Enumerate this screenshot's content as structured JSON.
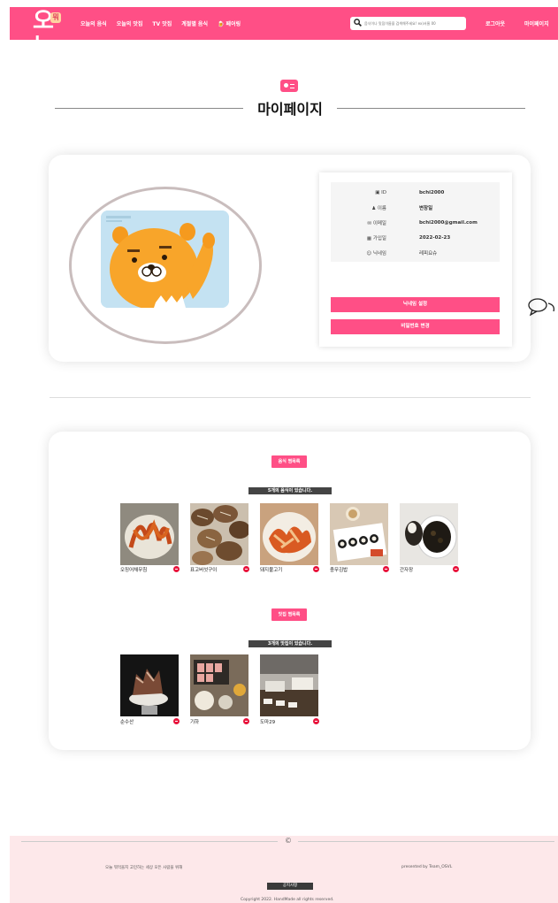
{
  "header": {
    "logo_text": "오늘",
    "logo_badge": "뭐",
    "nav": [
      "오늘의 음식",
      "오늘의 맛집",
      "TV 맛집",
      "계절별 음식",
      "🍺 페어링"
    ],
    "search_placeholder": "음식이나 맛집이름을 검색해주세요! ex)서울 00",
    "logout": "로그아웃",
    "mypage": "마이페이지"
  },
  "page": {
    "title": "마이페이지"
  },
  "profile": {
    "rows": [
      {
        "icon": "id-card-icon",
        "label": "ID",
        "value": "bchi2000"
      },
      {
        "icon": "person-icon",
        "label": "이름",
        "value": "변창일"
      },
      {
        "icon": "mail-icon",
        "label": "이메일",
        "value": "bchi2000@gmail.com"
      },
      {
        "icon": "calendar-icon",
        "label": "가입일",
        "value": "2022-02-23"
      },
      {
        "icon": "smile-icon",
        "label": "닉네임",
        "value": "레피요슈"
      }
    ],
    "nickname_button": "닉네임 설정",
    "password_button": "비밀번호 변경"
  },
  "food_bookmarks": {
    "button": "음식 찜목록",
    "count_text": "5개의 음식이 있습니다.",
    "items": [
      "오징어채무침",
      "표고버섯구이",
      "돼지불고기",
      "충무김밥",
      "간자장"
    ]
  },
  "restaurant_bookmarks": {
    "button": "맛집 찜목록",
    "count_text": "3개의 맛집이 있습니다.",
    "items": [
      "순수산",
      "기하",
      "도마29"
    ]
  },
  "footer": {
    "symbol": "©",
    "left_text": "오늘 뭐먹을지 고민하는 세상 모든 사람을 위해",
    "right_text": "presented by Team_OSVL",
    "notice_button": "공지사항",
    "copyright": "Copyright 2022. HandMade all rights reserved."
  },
  "colors": {
    "accent": "#ff4f86",
    "footer_bg": "#fde8ea",
    "remove": "#e8143c"
  }
}
